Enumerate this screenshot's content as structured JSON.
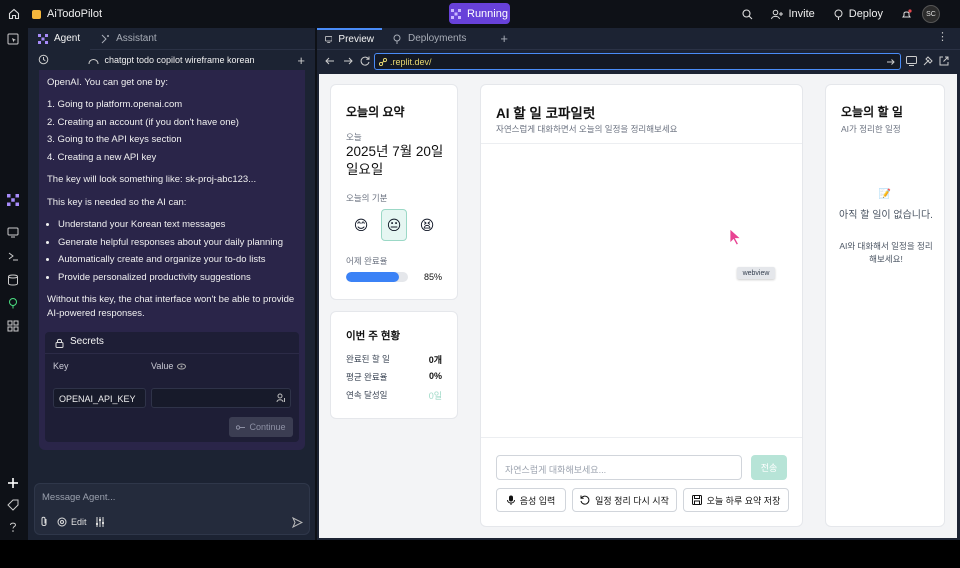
{
  "topbar": {
    "app_name": "AiTodoPilot",
    "status": "Running",
    "invite_label": "Invite",
    "deploy_label": "Deploy",
    "avatar_initials": "SC"
  },
  "agent_panel": {
    "tabs": [
      "Agent",
      "Assistant"
    ],
    "thread_title": "chatgpt todo copilot wireframe korean",
    "message": {
      "intro": "OpenAI. You can get one by:",
      "steps": [
        "1. Going to platform.openai.com",
        "2. Creating an account (if you don't have one)",
        "3. Going to the API keys section",
        "4. Creating a new API key"
      ],
      "key_example": "The key will look something like: sk-proj-abc123...",
      "need_intro": "This key is needed so the AI can:",
      "needs": [
        "Understand your Korean text messages",
        "Generate helpful responses about your daily planning",
        "Automatically create and organize your to-do lists",
        "Provide personalized productivity suggestions"
      ],
      "outro": "Without this key, the chat interface won't be able to provide AI-powered responses."
    },
    "secrets": {
      "title": "Secrets",
      "key_header": "Key",
      "value_header": "Value",
      "key_value": "OPENAI_API_KEY",
      "continue_label": "Continue"
    },
    "input": {
      "placeholder": "Message Agent...",
      "edit_label": "Edit"
    }
  },
  "workspace": {
    "tabs": [
      "Preview",
      "Deployments"
    ],
    "url": ".replit.dev/"
  },
  "webview": {
    "summary": {
      "title": "오늘의 요약",
      "today_label": "오늘",
      "date": "2025년 7월 20일",
      "weekday": "일요일",
      "mood_label": "오늘의 기분",
      "moods": [
        "😊",
        "😐",
        "😫"
      ],
      "selected_mood": 1,
      "yesterday_label": "어제 완료율",
      "yesterday_pct": 85,
      "yesterday_text": "85%"
    },
    "weekly": {
      "title": "이번 주 현황",
      "rows": [
        {
          "label": "완료된 할 일",
          "value": "0개"
        },
        {
          "label": "평균 완료율",
          "value": "0%"
        },
        {
          "label": "연속 달성일",
          "value": "0일"
        }
      ]
    },
    "copilot": {
      "title": "AI 할 일 코파일럿",
      "subtitle": "자연스럽게 대화하면서 오늘의 일정을 정리해보세요",
      "placeholder": "자연스럽게 대화해보세요...",
      "send_label": "전송",
      "actions": [
        "음성 입력",
        "일정 정리 다시 시작",
        "오늘 하루 요약 저장"
      ]
    },
    "todos": {
      "title": "오늘의 할 일",
      "subtitle": "AI가 정리한 일정",
      "empty_icon": "📝",
      "empty_line1": "아직 할 일이 없습니다.",
      "empty_line2": "AI와 대화해서 일정을 정리해보세요!"
    },
    "tag": "webview"
  },
  "colors": {
    "accent": "#6741d9",
    "progress": "#3b82f6",
    "url_border": "#4a8cf7"
  }
}
